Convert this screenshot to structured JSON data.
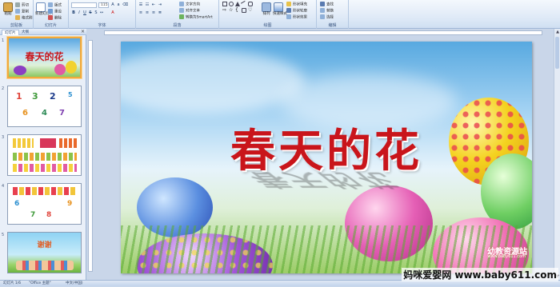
{
  "ribbon": {
    "groups": [
      {
        "name": "剪贴板",
        "buttons": [
          "粘贴",
          "剪切",
          "复制",
          "格式刷"
        ]
      },
      {
        "name": "幻灯片",
        "buttons": [
          "新建幻灯片",
          "版式",
          "重设",
          "删除"
        ]
      },
      {
        "name": "字体",
        "font_value": "",
        "size_value": "115"
      },
      {
        "name": "段落",
        "buttons": [
          "文字方向",
          "对齐文本",
          "转换为SmartArt"
        ]
      },
      {
        "name": "绘图",
        "buttons": [
          "排列",
          "快速样式",
          "形状填充",
          "形状轮廓",
          "形状效果"
        ]
      },
      {
        "name": "编辑",
        "buttons": [
          "查找",
          "替换",
          "选择"
        ]
      }
    ]
  },
  "pane_tabs": [
    "幻灯片",
    "大纲"
  ],
  "thumbnails": [
    {
      "number": "1",
      "title": "春天的花",
      "selected": true
    },
    {
      "number": "2",
      "content": [
        "1",
        "3",
        "2",
        "2",
        "5",
        "6",
        "4",
        "7"
      ]
    },
    {
      "number": "3",
      "content": []
    },
    {
      "number": "4",
      "content": [
        "6",
        "7",
        "8",
        "9"
      ]
    },
    {
      "number": "5",
      "title": "谢谢"
    }
  ],
  "slide": {
    "title": "春天的花",
    "watermark_text": "幼教资源站",
    "watermark_url": "www.baby611.com"
  },
  "statusbar": {
    "slide_info": "幻灯片 1/6",
    "theme": "\"Office 主题\"",
    "language": "中文(中国)"
  },
  "site_watermark": "妈咪爱婴网 www.baby611.com",
  "colors": {
    "title_red": "#c9151b",
    "ribbon_bg": "#dce8f6",
    "selection_orange": "#f2a93b"
  }
}
